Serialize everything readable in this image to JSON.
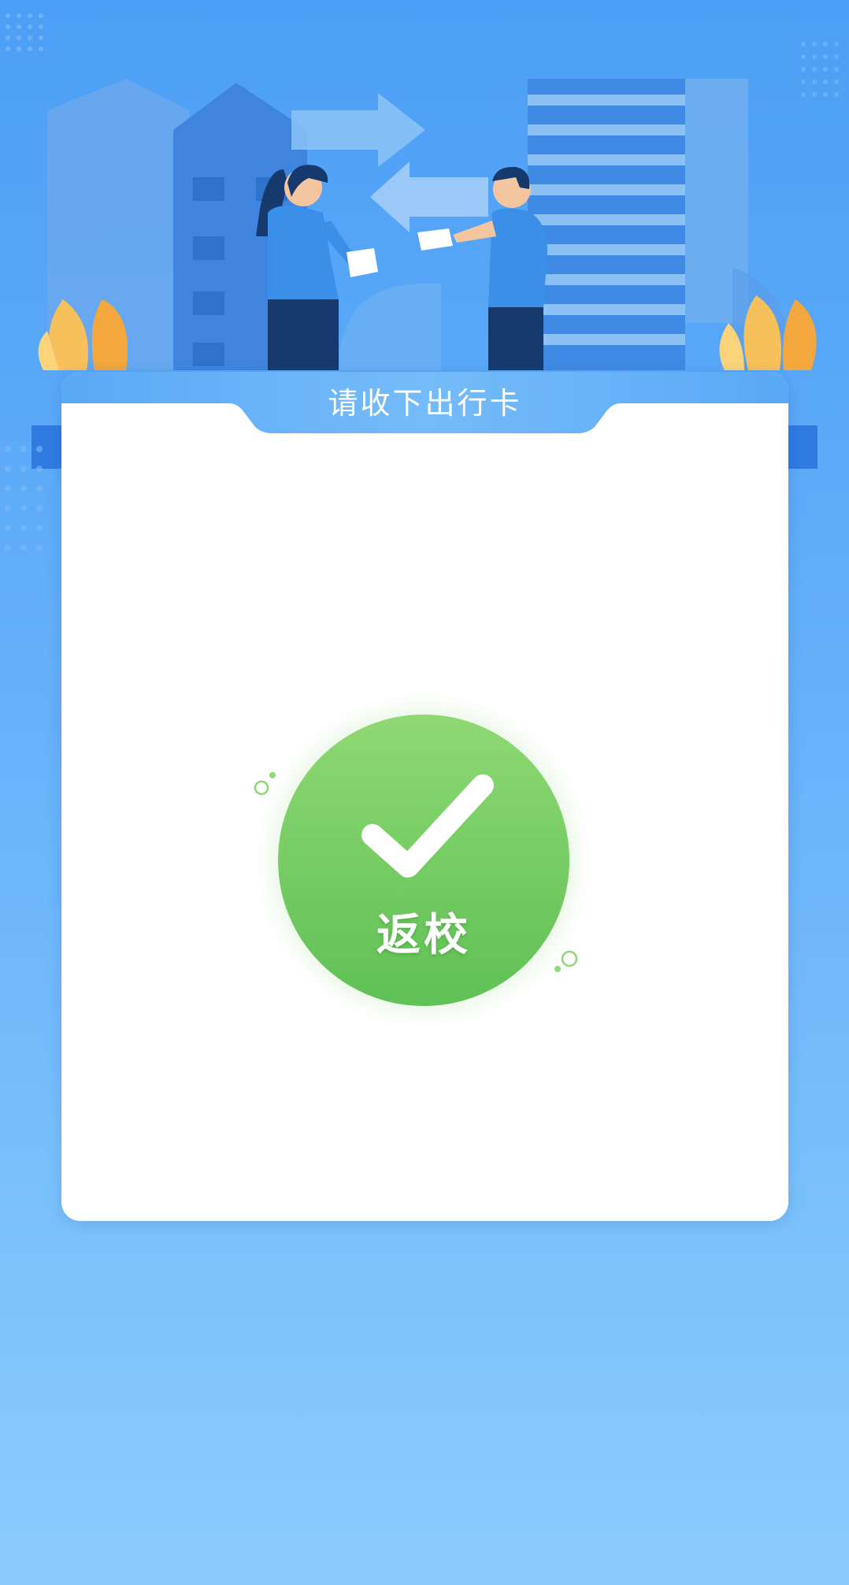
{
  "card": {
    "title": "请收下出行卡"
  },
  "status_badge": {
    "label": "返校",
    "icon": "checkmark-icon",
    "color": "#6cc95a"
  },
  "colors": {
    "background_top": "#4c9ff6",
    "background_bottom": "#8ccbfd",
    "card_header": "#6ab4f8",
    "badge_green": "#6cc95a"
  }
}
